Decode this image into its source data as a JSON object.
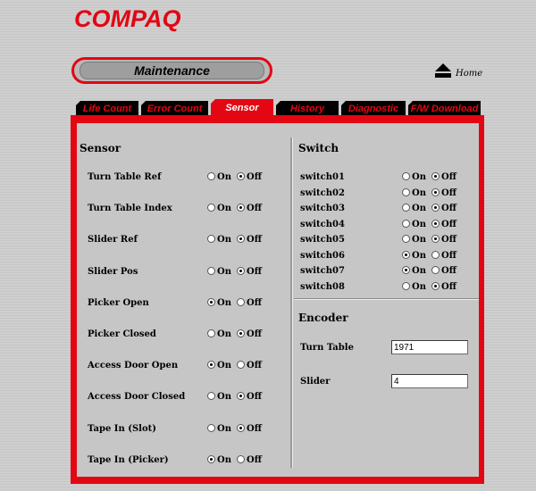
{
  "header": {
    "brand": "COMPAQ",
    "maintenance_label": "Maintenance",
    "home_label": "Home"
  },
  "tabs": [
    {
      "label": "Life Count",
      "active": false
    },
    {
      "label": "Error Count",
      "active": false
    },
    {
      "label": "Sensor",
      "active": true
    },
    {
      "label": "History",
      "active": false
    },
    {
      "label": "Diagnostic",
      "active": false
    },
    {
      "label": "F/W Download",
      "active": false
    }
  ],
  "sensor": {
    "title": "Sensor",
    "on_label": "On",
    "off_label": "Off",
    "rows": [
      {
        "label": "Turn Table Ref",
        "value": "Off"
      },
      {
        "label": "Turn Table Index",
        "value": "Off"
      },
      {
        "label": "Slider Ref",
        "value": "Off"
      },
      {
        "label": "Slider Pos",
        "value": "Off"
      },
      {
        "label": "Picker Open",
        "value": "On"
      },
      {
        "label": "Picker Closed",
        "value": "Off"
      },
      {
        "label": "Access Door Open",
        "value": "On"
      },
      {
        "label": "Access Door Closed",
        "value": "Off"
      },
      {
        "label": "Tape In (Slot)",
        "value": "Off"
      },
      {
        "label": "Tape In (Picker)",
        "value": "On"
      }
    ]
  },
  "switch": {
    "title": "Switch",
    "rows": [
      {
        "label": "switch01",
        "value": "Off"
      },
      {
        "label": "switch02",
        "value": "Off"
      },
      {
        "label": "switch03",
        "value": "Off"
      },
      {
        "label": "switch04",
        "value": "Off"
      },
      {
        "label": "switch05",
        "value": "Off"
      },
      {
        "label": "switch06",
        "value": "On"
      },
      {
        "label": "switch07",
        "value": "On"
      },
      {
        "label": "switch08",
        "value": "Off"
      }
    ]
  },
  "encoder": {
    "title": "Encoder",
    "turn_table_label": "Turn Table",
    "turn_table_value": "1971",
    "slider_label": "Slider",
    "slider_value": "4"
  },
  "colors": {
    "accent": "#e30613",
    "tab_bg": "#000000",
    "panel_bg": "#c6c6c6"
  }
}
